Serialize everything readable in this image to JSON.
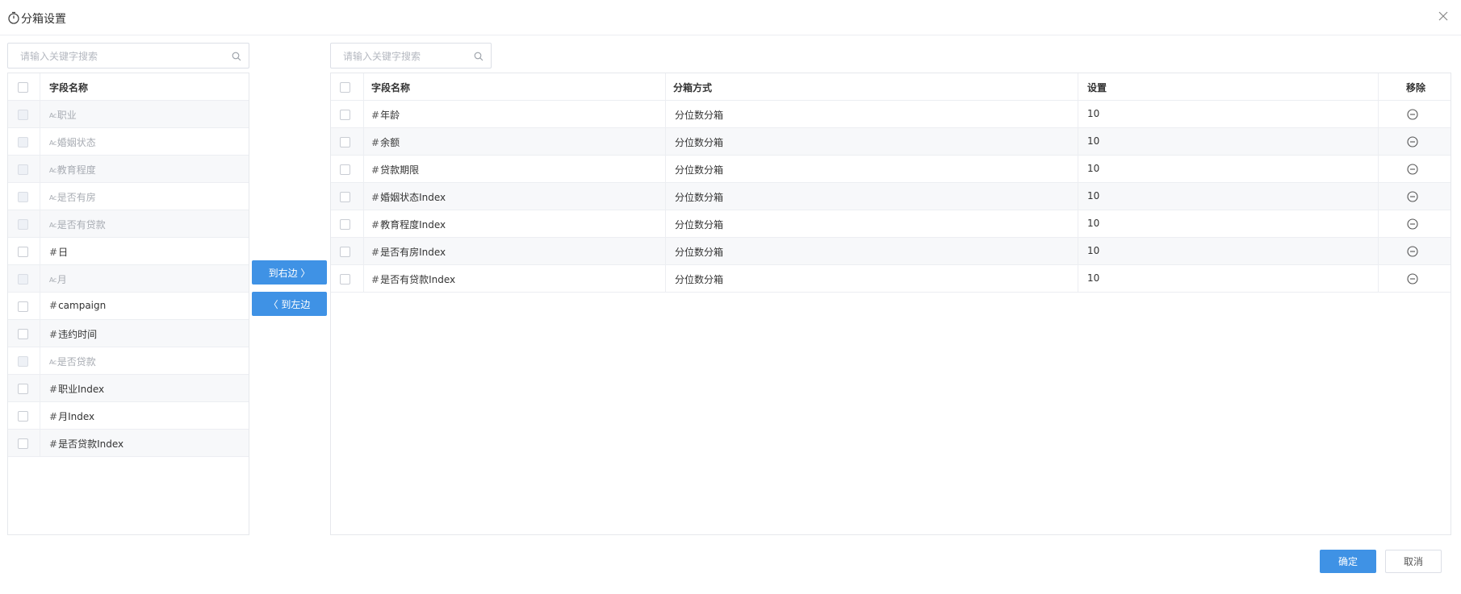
{
  "dialog": {
    "title": "分箱设置",
    "confirm_label": "确定",
    "cancel_label": "取消"
  },
  "left": {
    "search_placeholder": "请输入关键字搜索",
    "header": "字段名称",
    "items": [
      {
        "type": "Ac",
        "label": "职业",
        "disabled": true
      },
      {
        "type": "Ac",
        "label": "婚姻状态",
        "disabled": true
      },
      {
        "type": "Ac",
        "label": "教育程度",
        "disabled": true
      },
      {
        "type": "Ac",
        "label": "是否有房",
        "disabled": true
      },
      {
        "type": "Ac",
        "label": "是否有贷款",
        "disabled": true
      },
      {
        "type": "#",
        "label": "日",
        "disabled": false
      },
      {
        "type": "Ac",
        "label": "月",
        "disabled": true
      },
      {
        "type": "#",
        "label": "campaign",
        "disabled": false
      },
      {
        "type": "#",
        "label": "违约时间",
        "disabled": false
      },
      {
        "type": "Ac",
        "label": "是否贷款",
        "disabled": true
      },
      {
        "type": "#",
        "label": "职业Index",
        "disabled": false
      },
      {
        "type": "#",
        "label": "月Index",
        "disabled": false
      },
      {
        "type": "#",
        "label": "是否贷款Index",
        "disabled": false
      }
    ]
  },
  "transfer": {
    "to_right_label": "到右边 〉",
    "to_left_label": "〈 到左边"
  },
  "right": {
    "search_placeholder": "请输入关键字搜索",
    "columns": {
      "field": "字段名称",
      "method": "分箱方式",
      "setting": "设置",
      "remove": "移除"
    },
    "rows": [
      {
        "type": "#",
        "field": "年龄",
        "method": "分位数分箱",
        "setting": "10"
      },
      {
        "type": "#",
        "field": "余额",
        "method": "分位数分箱",
        "setting": "10"
      },
      {
        "type": "#",
        "field": "贷款期限",
        "method": "分位数分箱",
        "setting": "10"
      },
      {
        "type": "#",
        "field": "婚姻状态Index",
        "method": "分位数分箱",
        "setting": "10"
      },
      {
        "type": "#",
        "field": "教育程度Index",
        "method": "分位数分箱",
        "setting": "10"
      },
      {
        "type": "#",
        "field": "是否有房Index",
        "method": "分位数分箱",
        "setting": "10"
      },
      {
        "type": "#",
        "field": "是否有贷款Index",
        "method": "分位数分箱",
        "setting": "10"
      }
    ]
  },
  "icons": {
    "title": "timer-icon",
    "close": "close-icon",
    "search": "search-icon",
    "remove": "minus-circle-icon"
  },
  "colors": {
    "primary": "#3f92e5",
    "border": "#e6e8ec",
    "muted_text": "#a8acb3"
  }
}
